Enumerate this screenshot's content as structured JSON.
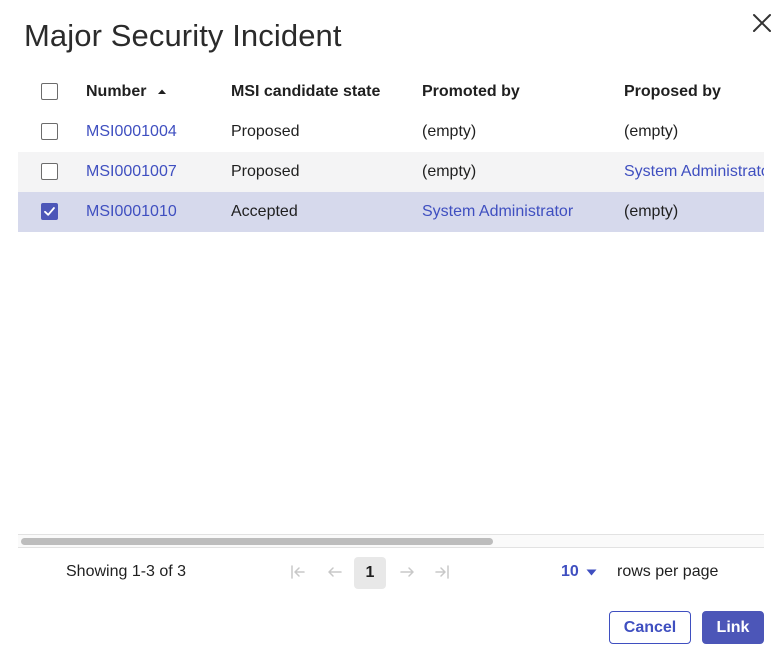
{
  "dialog": {
    "title": "Major Security Incident",
    "close_icon": "close-icon"
  },
  "table": {
    "columns": {
      "number": "Number",
      "state": "MSI candidate state",
      "promoted_by": "Promoted by",
      "proposed_by": "Proposed by"
    },
    "sort": {
      "column": "Number",
      "direction": "ascending",
      "icon": "sort-ascending-icon"
    },
    "rows": [
      {
        "number": "MSI0001004",
        "state": "Proposed",
        "promoted_by": "(empty)",
        "proposed_by": "(empty)",
        "checked": false
      },
      {
        "number": "MSI0001007",
        "state": "Proposed",
        "promoted_by": "(empty)",
        "proposed_by": "System Administrator",
        "checked": false
      },
      {
        "number": "MSI0001010",
        "state": "Accepted",
        "promoted_by": "System Administrator",
        "proposed_by": "(empty)",
        "checked": true
      }
    ]
  },
  "pagination": {
    "showing": "Showing 1-3 of 3",
    "current_page": "1",
    "rows_per_page_value": "10",
    "rows_per_page_label": "rows per page",
    "icons": [
      "first-page-icon",
      "previous-page-icon",
      "next-page-icon",
      "last-page-icon"
    ]
  },
  "actions": {
    "cancel_label": "Cancel",
    "link_label": "Link"
  },
  "colors": {
    "accent": "#4c56b8",
    "link": "#3f4fc0",
    "selected_row": "#d6d9ec",
    "alt_row": "#f4f4f5"
  }
}
